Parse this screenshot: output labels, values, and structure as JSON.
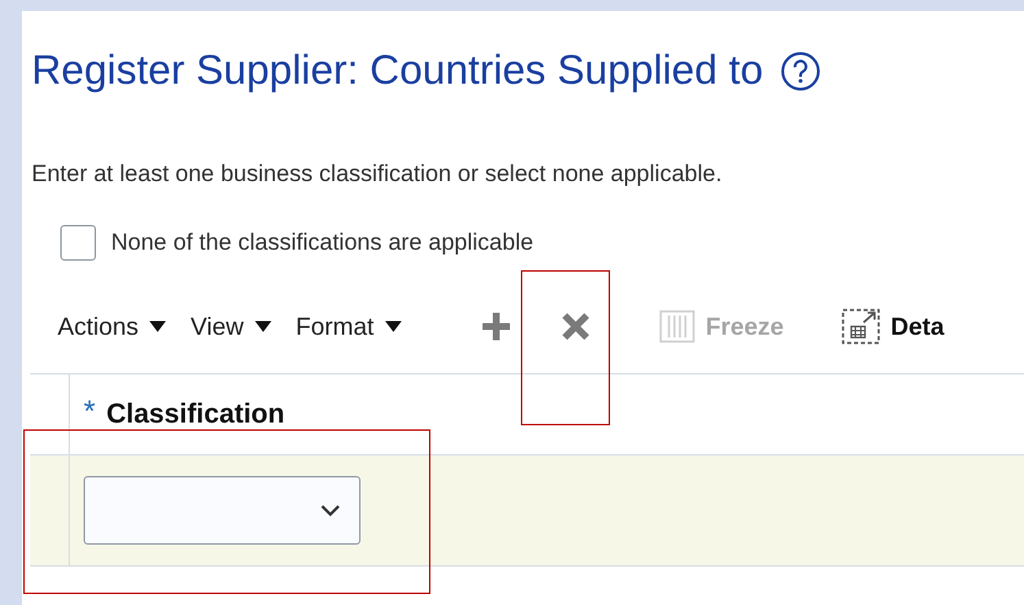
{
  "page": {
    "title": "Register Supplier: Countries Supplied to",
    "instruction": "Enter at least one business classification or select none applicable."
  },
  "none_applicable": {
    "label": "None of the classifications are applicable",
    "checked": false
  },
  "toolbar": [
    {
      "kind": "menu",
      "label": "Actions",
      "disabled": false
    },
    {
      "kind": "menu",
      "label": "View",
      "disabled": false
    },
    {
      "kind": "menu",
      "label": "Format",
      "disabled": false
    },
    {
      "kind": "add",
      "disabled": false
    },
    {
      "kind": "delete",
      "disabled": false
    },
    {
      "kind": "freeze",
      "label": "Freeze",
      "disabled": true
    },
    {
      "kind": "detach",
      "label": "Deta",
      "disabled": false
    }
  ],
  "table": {
    "columns": [
      {
        "label": "Classification",
        "required": true,
        "required_mark": "*"
      }
    ],
    "rows": [
      {
        "selected": true
      }
    ]
  }
}
